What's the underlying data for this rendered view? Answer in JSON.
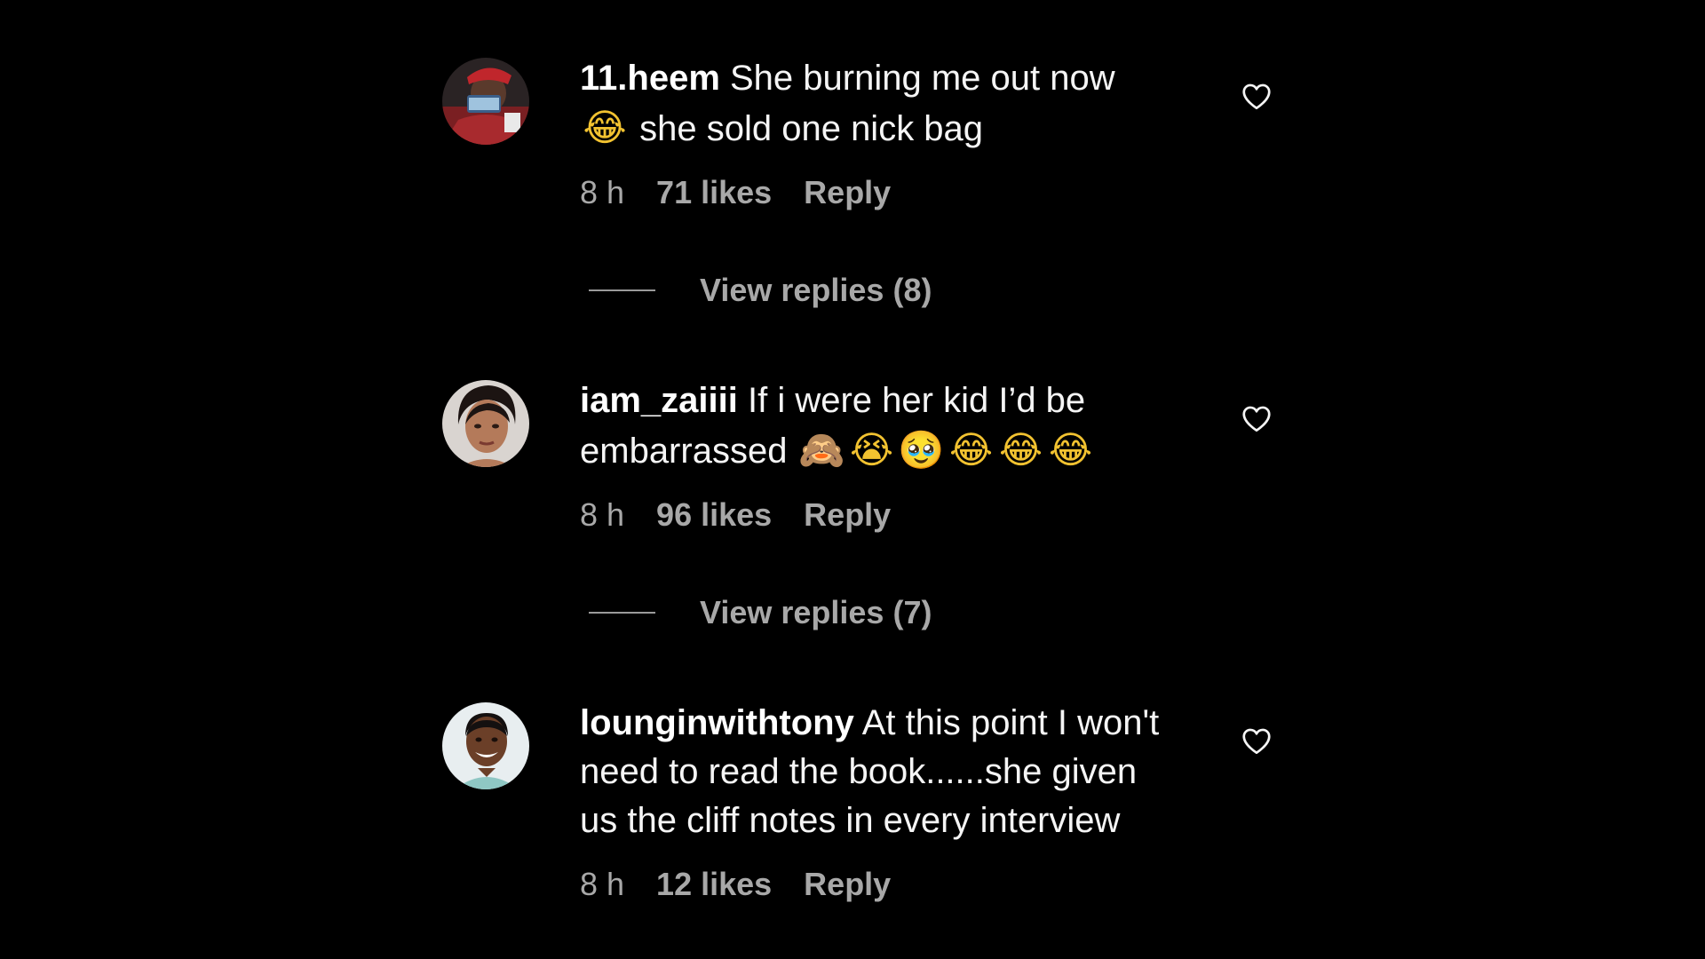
{
  "comments": [
    {
      "username": "11.heem",
      "text_a": " She burning me out now",
      "emoji_a": "😂",
      "text_b": " she sold one nick bag",
      "time": "8 h",
      "likes": "71 likes",
      "reply": "Reply",
      "view_replies": "View replies (8)",
      "heart_icon": "heart-outline-icon"
    },
    {
      "username": "iam_zaiiii",
      "text_a": " If i were her kid I’d be embarrassed ",
      "emojis": [
        "🙈",
        "😭",
        "🥹",
        "😂",
        "😂",
        "😂"
      ],
      "time": "8 h",
      "likes": "96 likes",
      "reply": "Reply",
      "view_replies": "View replies (7)",
      "heart_icon": "heart-outline-icon"
    },
    {
      "username": "lounginwithtony",
      "text_a": " At this point I won't need to read the book......she given us the cliff notes in every interview",
      "time": "8 h",
      "likes": "12 likes",
      "reply": "Reply",
      "heart_icon": "heart-outline-icon"
    }
  ],
  "colors": {
    "background": "#000000",
    "primary_text": "#f5f5f5",
    "secondary_text": "#a8a8a8"
  }
}
